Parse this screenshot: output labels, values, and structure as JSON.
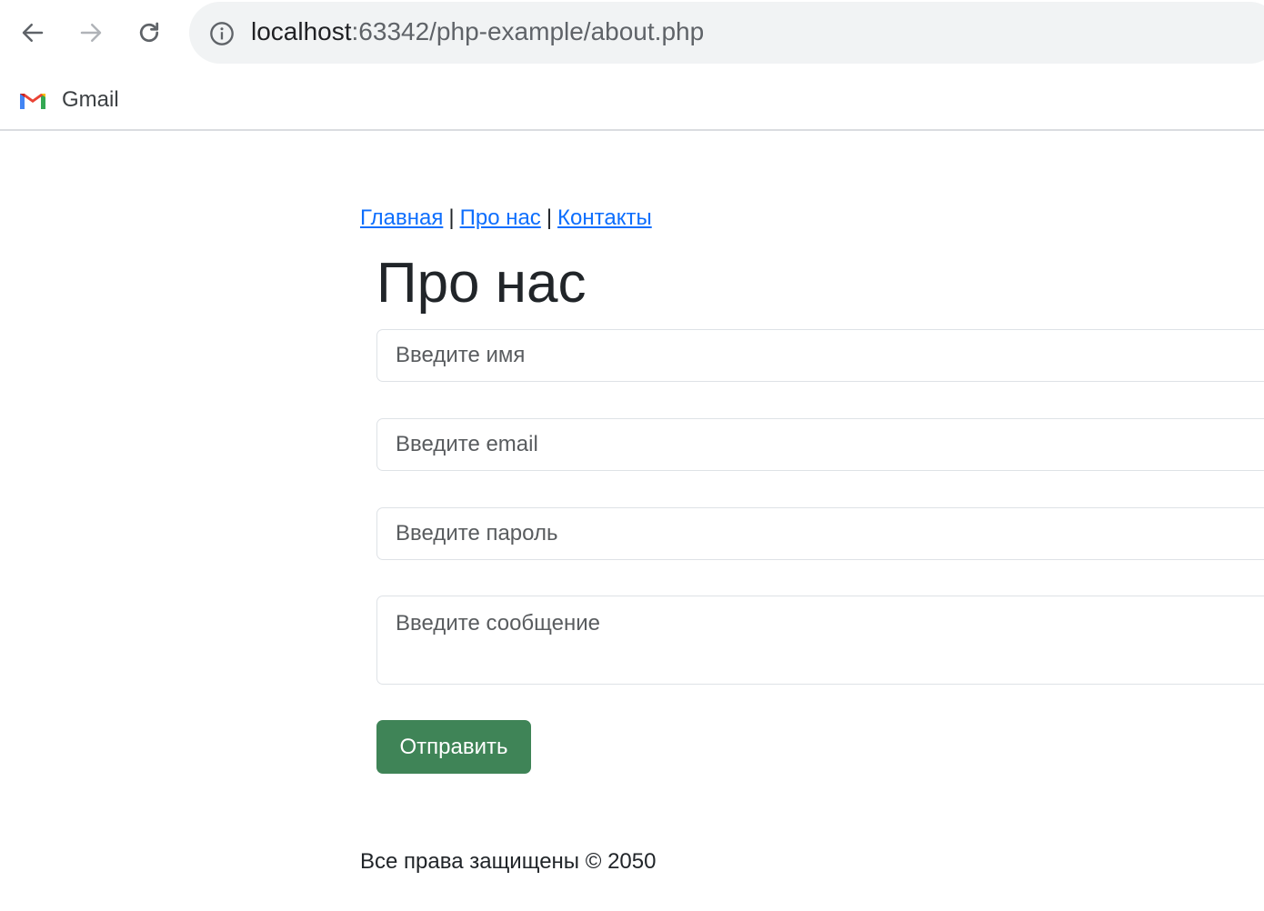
{
  "browser": {
    "url_host": "localhost",
    "url_rest": ":63342/php-example/about.php",
    "bookmarks": [
      {
        "label": "Gmail",
        "icon": "gmail-icon"
      }
    ],
    "icons": {
      "back": "back-arrow-icon",
      "forward": "forward-arrow-icon",
      "reload": "reload-icon",
      "site_info": "info-icon"
    }
  },
  "nav": {
    "home": "Главная",
    "about": "Про нас",
    "contacts": "Контакты",
    "separator": "|"
  },
  "page": {
    "title": "Про нас"
  },
  "form": {
    "name_placeholder": "Введите имя",
    "email_placeholder": "Введите email",
    "password_placeholder": "Введите пароль",
    "message_placeholder": "Введите сообщение",
    "submit_label": "Отправить"
  },
  "footer": {
    "text": "Все права защищены © 2050"
  },
  "colors": {
    "link": "#0d6efd",
    "submit_button": "#3f8457",
    "omnibox_bg": "#f1f3f4"
  }
}
